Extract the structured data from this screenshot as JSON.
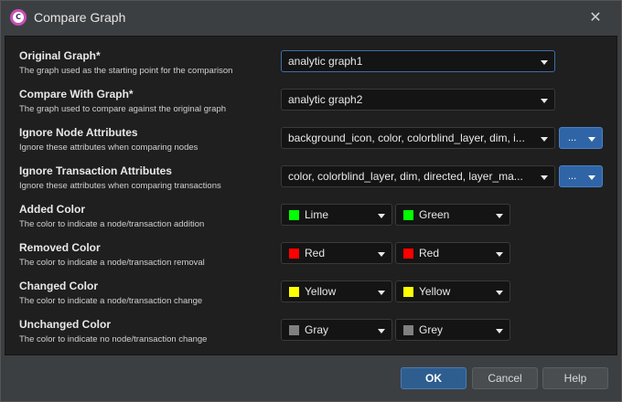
{
  "window": {
    "title": "Compare Graph",
    "close_glyph": "✕"
  },
  "app_icon": {
    "glyph": "C"
  },
  "fields": [
    {
      "label": "Original Graph*",
      "description": "The graph used as the starting point for the comparison",
      "value": "analytic graph1"
    },
    {
      "label": "Compare With Graph*",
      "description": "The graph used to compare against the original graph",
      "value": "analytic graph2"
    },
    {
      "label": "Ignore Node Attributes",
      "description": "Ignore these attributes when comparing nodes",
      "value": "background_icon, color, colorblind_layer, dim, i...",
      "button": "..."
    },
    {
      "label": "Ignore Transaction Attributes",
      "description": "Ignore these attributes when comparing transactions",
      "value": "color, colorblind_layer, dim, directed, layer_ma...",
      "button": "..."
    },
    {
      "label": "Added Color",
      "description": "The color to indicate a node/transaction addition",
      "preset": {
        "name": "Lime",
        "color": "#00ff00"
      },
      "value": {
        "name": "Green",
        "color": "#00ff00"
      }
    },
    {
      "label": "Removed Color",
      "description": "The color to indicate a node/transaction removal",
      "preset": {
        "name": "Red",
        "color": "#ff0000"
      },
      "value": {
        "name": "Red",
        "color": "#ff0000"
      }
    },
    {
      "label": "Changed Color",
      "description": "The color to indicate a node/transaction change",
      "preset": {
        "name": "Yellow",
        "color": "#ffff00"
      },
      "value": {
        "name": "Yellow",
        "color": "#ffff00"
      }
    },
    {
      "label": "Unchanged Color",
      "description": "The color to indicate no node/transaction change",
      "preset": {
        "name": "Gray",
        "color": "#808080"
      },
      "value": {
        "name": "Grey",
        "color": "#808080"
      }
    }
  ],
  "buttons": {
    "ok": "OK",
    "cancel": "Cancel",
    "help": "Help"
  },
  "colors": {
    "accent": "#2f65a7",
    "background": "#1f1f1f"
  }
}
